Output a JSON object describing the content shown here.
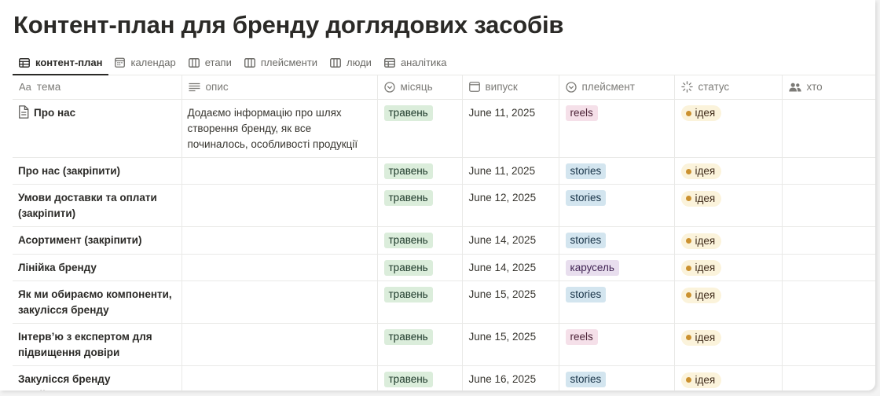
{
  "page": {
    "title": "Контент-план для бренду доглядових засобів"
  },
  "tabs": [
    {
      "label": "контент-план",
      "icon": "table-icon",
      "active": true
    },
    {
      "label": "календар",
      "icon": "calendar-icon",
      "active": false
    },
    {
      "label": "етапи",
      "icon": "board-icon",
      "active": false
    },
    {
      "label": "плейсменти",
      "icon": "board-icon",
      "active": false
    },
    {
      "label": "люди",
      "icon": "board-icon",
      "active": false
    },
    {
      "label": "аналітика",
      "icon": "table-icon",
      "active": false
    }
  ],
  "columns": [
    {
      "label": "тема",
      "prefix": "Aa",
      "icon": "text-icon"
    },
    {
      "label": "опис",
      "icon": "lines-icon"
    },
    {
      "label": "місяць",
      "icon": "select-icon"
    },
    {
      "label": "випуск",
      "icon": "date-icon"
    },
    {
      "label": "плейсмент",
      "icon": "select-icon"
    },
    {
      "label": "статус",
      "icon": "status-icon"
    },
    {
      "label": "хто",
      "icon": "people-icon"
    }
  ],
  "rows": [
    {
      "name": "Про нас",
      "page_icon": true,
      "description": "Додаємо інформацію про шлях створення бренду, як все починалось, особливості продукції",
      "month": "травень",
      "date": "June 11, 2025",
      "placement": "reels",
      "placement_color": "pink",
      "status": "ідея",
      "who": ""
    },
    {
      "name": "Про нас (закріпити)",
      "page_icon": false,
      "description": "",
      "month": "травень",
      "date": "June 11, 2025",
      "placement": "stories",
      "placement_color": "blue",
      "status": "ідея",
      "who": ""
    },
    {
      "name": "Умови доставки та оплати (закріпити)",
      "page_icon": false,
      "description": "",
      "month": "травень",
      "date": "June 12, 2025",
      "placement": "stories",
      "placement_color": "blue",
      "status": "ідея",
      "who": ""
    },
    {
      "name": "Асортимент (закріпити)",
      "page_icon": false,
      "description": "",
      "month": "травень",
      "date": "June 14, 2025",
      "placement": "stories",
      "placement_color": "blue",
      "status": "ідея",
      "who": ""
    },
    {
      "name": "Лінійка бренду",
      "page_icon": false,
      "description": "",
      "month": "травень",
      "date": "June 14, 2025",
      "placement": "карусель",
      "placement_color": "purple",
      "status": "ідея",
      "who": ""
    },
    {
      "name": "Як ми обираємо компоненти, закулісся бренду",
      "page_icon": false,
      "description": "",
      "month": "травень",
      "date": "June 15, 2025",
      "placement": "stories",
      "placement_color": "blue",
      "status": "ідея",
      "who": ""
    },
    {
      "name": "Інтерв’ю з експертом для підвищення довіри",
      "page_icon": false,
      "description": "",
      "month": "травень",
      "date": "June 15, 2025",
      "placement": "reels",
      "placement_color": "pink",
      "status": "ідея",
      "who": ""
    },
    {
      "name": "Закулісся бренду (знайомство з командою)",
      "page_icon": false,
      "description": "",
      "month": "травень",
      "date": "June 16, 2025",
      "placement": "stories",
      "placement_color": "blue",
      "status": "ідея",
      "who": ""
    }
  ]
}
